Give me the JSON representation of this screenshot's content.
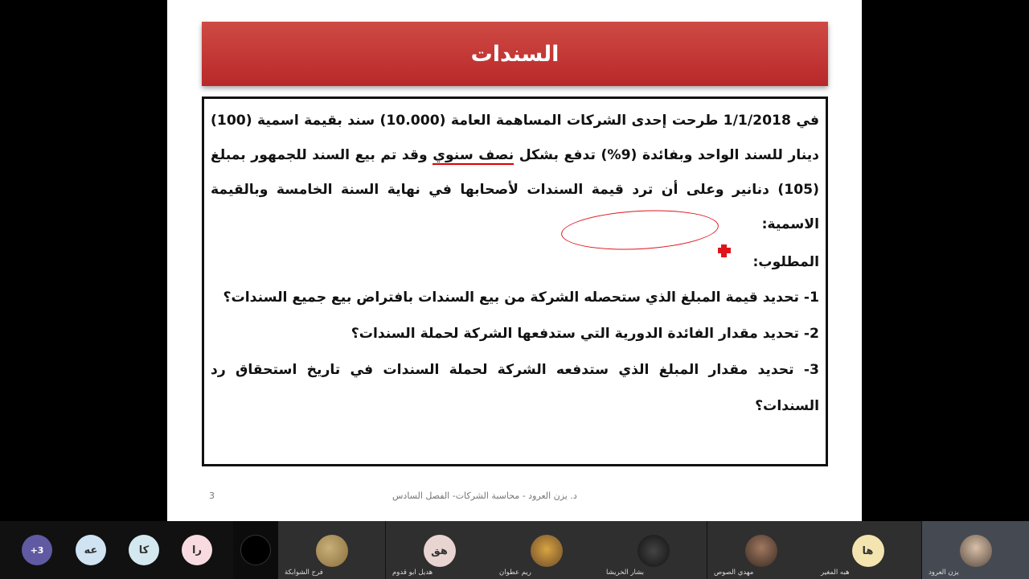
{
  "slide": {
    "title": "السندات",
    "problem": {
      "line1_a": "في ",
      "date": "1/1/2018",
      "line1_b": " طرحت إحدى الشركات المساهمة العامة (",
      "count": "10.000",
      "line1_c": ") سند بقيمة اسمية (",
      "face": "100",
      "line2_a": ") دينار للسند الواحد وبفائدة (",
      "rate": "9%",
      "line2_b": ") تدفع بشكل ",
      "semi_annual": "نصف سنوي",
      "line2_c": " وقد تم بيع السند للجمهور بمبلغ (",
      "price": "105",
      "line3_a": ") دنانير وعلى أن ترد قيمة السندات لأصحابها في نهاية السنة الخامسة وبالقيمة الاسمية:"
    },
    "required_label": "المطلوب:",
    "items": [
      {
        "num": "1",
        "text": "- تحديد قيمة المبلغ الذي ستحصله الشركة من بيع السندات بافتراض بيع جميع السندات؟"
      },
      {
        "num": "2",
        "text": "- تحديد مقدار الفائدة الدورية التي ستدفعها الشركة لحملة السندات؟"
      },
      {
        "num": "3",
        "text": "- تحديد مقدار المبلغ الذي ستدفعه الشركة لحملة السندات في تاريخ استحقاق رد السندات؟"
      }
    ],
    "page_number": "3",
    "footer": "د. يزن العرود - محاسبة الشركات- الفصل السادس"
  },
  "participants": {
    "more": "+3",
    "circles": [
      {
        "initials": "عه",
        "color": "#cfe3f3"
      },
      {
        "initials": "كا",
        "color": "#d3e9ef"
      },
      {
        "initials": "را",
        "color": "#f8dbe0"
      }
    ],
    "tiles": [
      {
        "name": "فرح الشوابكة",
        "avatar": "photo-icon"
      },
      {
        "name": "هديل ابو قدوم",
        "initials": "هق"
      },
      {
        "name": "ريم عطوان",
        "avatar": "photo-icon"
      },
      {
        "name": "بشار الخريشا",
        "avatar": "photo-icon"
      },
      {
        "name": "مهدي الصوص",
        "avatar": "photo-icon"
      },
      {
        "name": "هبه المغير",
        "initials": "ها"
      },
      {
        "name": "يزن العرود",
        "avatar": "photo-icon"
      }
    ]
  }
}
